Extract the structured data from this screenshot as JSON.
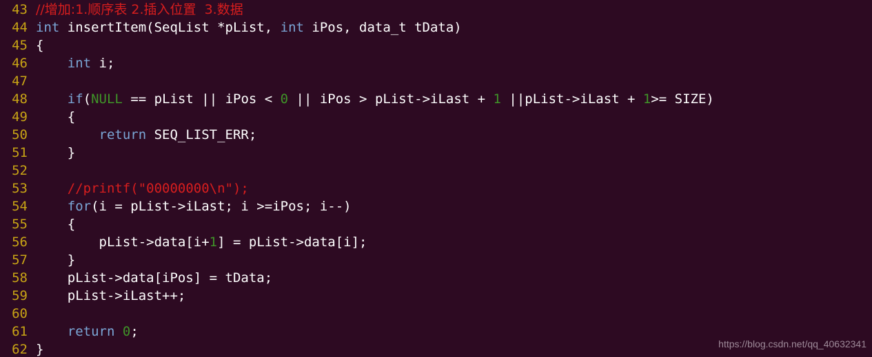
{
  "editor": {
    "background_color": "#2d0a22",
    "gutter_color": "#c8a415",
    "first_line_number": 43,
    "last_line_number": 62,
    "language": "c",
    "font_size_px": 19,
    "line_height_px": 26
  },
  "theme": {
    "plain": "#ffffff",
    "keyword": "#7ba7d7",
    "number": "#3f9428",
    "constant": "#3f9428",
    "comment": "#d81e1e",
    "string": "#d81e1e",
    "line_number": "#c8a415",
    "watermark": "#9e8a99"
  },
  "watermark": {
    "text": "https://blog.csdn.net/qq_40632341"
  },
  "code": {
    "lines": [
      {
        "number": "43",
        "text": "//增加:1.顺序表 2.插入位置  3.数据",
        "tokens": [
          {
            "t": "//增加:1.顺序表 2.插入位置  3.数据",
            "c": "comment"
          }
        ]
      },
      {
        "number": "44",
        "text": "int insertItem(SeqList *pList, int iPos, data_t tData)",
        "tokens": [
          {
            "t": "int",
            "c": "kw"
          },
          {
            "t": " insertItem(SeqList *pList, ",
            "c": "plain"
          },
          {
            "t": "int",
            "c": "kw"
          },
          {
            "t": " iPos, data_t tData)",
            "c": "plain"
          }
        ]
      },
      {
        "number": "45",
        "text": "{",
        "tokens": [
          {
            "t": "{",
            "c": "plain"
          }
        ]
      },
      {
        "number": "46",
        "text": "    int i;",
        "tokens": [
          {
            "t": "    ",
            "c": "plain"
          },
          {
            "t": "int",
            "c": "kw"
          },
          {
            "t": " i;",
            "c": "plain"
          }
        ]
      },
      {
        "number": "47",
        "text": "",
        "tokens": []
      },
      {
        "number": "48",
        "text": "    if(NULL == pList || iPos < 0 || iPos > pList->iLast + 1 ||pList->iLast + 1>= SIZE)",
        "tokens": [
          {
            "t": "    ",
            "c": "plain"
          },
          {
            "t": "if",
            "c": "kw"
          },
          {
            "t": "(",
            "c": "plain"
          },
          {
            "t": "NULL",
            "c": "const"
          },
          {
            "t": " == pList || iPos < ",
            "c": "plain"
          },
          {
            "t": "0",
            "c": "num"
          },
          {
            "t": " || iPos > pList->iLast + ",
            "c": "plain"
          },
          {
            "t": "1",
            "c": "num"
          },
          {
            "t": " ||pList->iLast + ",
            "c": "plain"
          },
          {
            "t": "1",
            "c": "num"
          },
          {
            "t": ">= SIZE)",
            "c": "plain"
          }
        ]
      },
      {
        "number": "49",
        "text": "    {",
        "tokens": [
          {
            "t": "    {",
            "c": "plain"
          }
        ]
      },
      {
        "number": "50",
        "text": "        return SEQ_LIST_ERR;",
        "tokens": [
          {
            "t": "        ",
            "c": "plain"
          },
          {
            "t": "return",
            "c": "kw"
          },
          {
            "t": " SEQ_LIST_ERR;",
            "c": "plain"
          }
        ]
      },
      {
        "number": "51",
        "text": "    }",
        "tokens": [
          {
            "t": "    }",
            "c": "plain"
          }
        ]
      },
      {
        "number": "52",
        "text": "",
        "tokens": []
      },
      {
        "number": "53",
        "text": "    //printf(\"00000000\\n\");",
        "tokens": [
          {
            "t": "    ",
            "c": "plain"
          },
          {
            "t": "//printf(\"00000000\\n\");",
            "c": "comment"
          }
        ]
      },
      {
        "number": "54",
        "text": "    for(i = pList->iLast; i >=iPos; i--)",
        "tokens": [
          {
            "t": "    ",
            "c": "plain"
          },
          {
            "t": "for",
            "c": "kw"
          },
          {
            "t": "(i = pList->iLast; i >=iPos; i--)",
            "c": "plain"
          }
        ]
      },
      {
        "number": "55",
        "text": "    {",
        "tokens": [
          {
            "t": "    {",
            "c": "plain"
          }
        ]
      },
      {
        "number": "56",
        "text": "        pList->data[i+1] = pList->data[i];",
        "tokens": [
          {
            "t": "        pList->data[i+",
            "c": "plain"
          },
          {
            "t": "1",
            "c": "num"
          },
          {
            "t": "] = pList->data[i];",
            "c": "plain"
          }
        ]
      },
      {
        "number": "57",
        "text": "    }",
        "tokens": [
          {
            "t": "    }",
            "c": "plain"
          }
        ]
      },
      {
        "number": "58",
        "text": "    pList->data[iPos] = tData;",
        "tokens": [
          {
            "t": "    pList->data[iPos] = tData;",
            "c": "plain"
          }
        ]
      },
      {
        "number": "59",
        "text": "    pList->iLast++;",
        "tokens": [
          {
            "t": "    pList->iLast++;",
            "c": "plain"
          }
        ]
      },
      {
        "number": "60",
        "text": "",
        "tokens": []
      },
      {
        "number": "61",
        "text": "    return 0;",
        "tokens": [
          {
            "t": "    ",
            "c": "plain"
          },
          {
            "t": "return",
            "c": "kw"
          },
          {
            "t": " ",
            "c": "plain"
          },
          {
            "t": "0",
            "c": "num"
          },
          {
            "t": ";",
            "c": "plain"
          }
        ]
      },
      {
        "number": "62",
        "text": "}",
        "tokens": [
          {
            "t": "}",
            "c": "plain"
          }
        ]
      }
    ]
  }
}
